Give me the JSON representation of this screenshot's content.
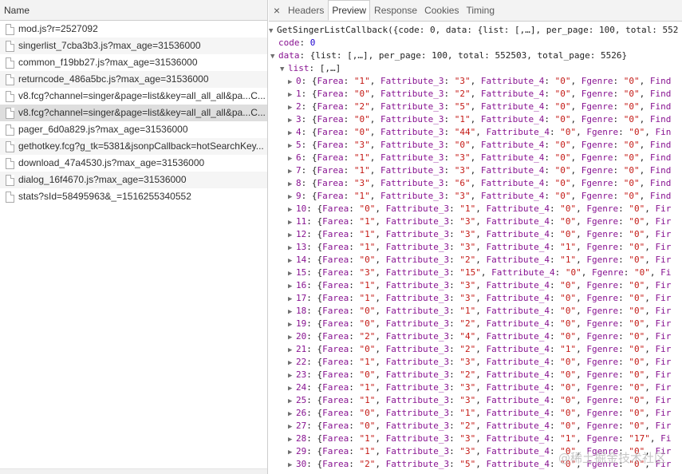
{
  "network": {
    "header": "Name",
    "requests": [
      "mod.js?r=2527092",
      "singerlist_7cba3b3.js?max_age=31536000",
      "common_f19bb27.js?max_age=31536000",
      "returncode_486a5bc.js?max_age=31536000",
      "v8.fcg?channel=singer&page=list&key=all_all_all&pa...C...",
      "v8.fcg?channel=singer&page=list&key=all_all_all&pa...C...",
      "pager_6d0a829.js?max_age=31536000",
      "gethotkey.fcg?g_tk=5381&jsonpCallback=hotSearchKey...",
      "download_47a4530.js?max_age=31536000",
      "dialog_16f4670.js?max_age=31536000",
      "stats?sId=58495963&_=1516255340552"
    ],
    "selected_index": 5
  },
  "detail": {
    "close_icon": "×",
    "tabs": [
      "Headers",
      "Preview",
      "Response",
      "Cookies",
      "Timing"
    ],
    "active_tab": 1
  },
  "preview": {
    "root": "GetSingerListCallback({code: 0, data: {list: [,…], per_page: 100, total: 552",
    "code_key": "code",
    "code_val": "0",
    "data_key": "data",
    "data_summary": "{list: [,…], per_page: 100, total: 552503, total_page: 5526}",
    "list_key": "list",
    "list_summary": "[,…]",
    "items": [
      {
        "i": "0",
        "farea": "1",
        "f3": "3",
        "f4": "0",
        "fgenre": "0",
        "tail": "Find"
      },
      {
        "i": "1",
        "farea": "0",
        "f3": "2",
        "f4": "0",
        "fgenre": "0",
        "tail": "Find"
      },
      {
        "i": "2",
        "farea": "2",
        "f3": "5",
        "f4": "0",
        "fgenre": "0",
        "tail": "Find"
      },
      {
        "i": "3",
        "farea": "0",
        "f3": "1",
        "f4": "0",
        "fgenre": "0",
        "tail": "Find"
      },
      {
        "i": "4",
        "farea": "0",
        "f3": "44",
        "f4": "0",
        "fgenre": "0",
        "tail": "Fin"
      },
      {
        "i": "5",
        "farea": "3",
        "f3": "0",
        "f4": "0",
        "fgenre": "0",
        "tail": "Find"
      },
      {
        "i": "6",
        "farea": "1",
        "f3": "3",
        "f4": "0",
        "fgenre": "0",
        "tail": "Find"
      },
      {
        "i": "7",
        "farea": "1",
        "f3": "3",
        "f4": "0",
        "fgenre": "0",
        "tail": "Find"
      },
      {
        "i": "8",
        "farea": "3",
        "f3": "6",
        "f4": "0",
        "fgenre": "0",
        "tail": "Find"
      },
      {
        "i": "9",
        "farea": "1",
        "f3": "3",
        "f4": "0",
        "fgenre": "0",
        "tail": "Find"
      },
      {
        "i": "10",
        "farea": "0",
        "f3": "1",
        "f4": "0",
        "fgenre": "0",
        "tail": "Fir"
      },
      {
        "i": "11",
        "farea": "1",
        "f3": "3",
        "f4": "0",
        "fgenre": "0",
        "tail": "Fir"
      },
      {
        "i": "12",
        "farea": "1",
        "f3": "3",
        "f4": "0",
        "fgenre": "0",
        "tail": "Fir"
      },
      {
        "i": "13",
        "farea": "1",
        "f3": "3",
        "f4": "1",
        "fgenre": "0",
        "tail": "Fir"
      },
      {
        "i": "14",
        "farea": "0",
        "f3": "2",
        "f4": "1",
        "fgenre": "0",
        "tail": "Fir"
      },
      {
        "i": "15",
        "farea": "3",
        "f3": "15",
        "f4": "0",
        "fgenre": "0",
        "tail": "Fi"
      },
      {
        "i": "16",
        "farea": "1",
        "f3": "3",
        "f4": "0",
        "fgenre": "0",
        "tail": "Fir"
      },
      {
        "i": "17",
        "farea": "1",
        "f3": "3",
        "f4": "0",
        "fgenre": "0",
        "tail": "Fir"
      },
      {
        "i": "18",
        "farea": "0",
        "f3": "1",
        "f4": "0",
        "fgenre": "0",
        "tail": "Fir"
      },
      {
        "i": "19",
        "farea": "0",
        "f3": "2",
        "f4": "0",
        "fgenre": "0",
        "tail": "Fir"
      },
      {
        "i": "20",
        "farea": "2",
        "f3": "4",
        "f4": "0",
        "fgenre": "0",
        "tail": "Fir"
      },
      {
        "i": "21",
        "farea": "0",
        "f3": "2",
        "f4": "1",
        "fgenre": "0",
        "tail": "Fir"
      },
      {
        "i": "22",
        "farea": "1",
        "f3": "3",
        "f4": "0",
        "fgenre": "0",
        "tail": "Fir"
      },
      {
        "i": "23",
        "farea": "0",
        "f3": "2",
        "f4": "0",
        "fgenre": "0",
        "tail": "Fir"
      },
      {
        "i": "24",
        "farea": "1",
        "f3": "3",
        "f4": "0",
        "fgenre": "0",
        "tail": "Fir"
      },
      {
        "i": "25",
        "farea": "1",
        "f3": "3",
        "f4": "0",
        "fgenre": "0",
        "tail": "Fir"
      },
      {
        "i": "26",
        "farea": "0",
        "f3": "1",
        "f4": "0",
        "fgenre": "0",
        "tail": "Fir"
      },
      {
        "i": "27",
        "farea": "0",
        "f3": "2",
        "f4": "0",
        "fgenre": "0",
        "tail": "Fir"
      },
      {
        "i": "28",
        "farea": "1",
        "f3": "3",
        "f4": "1",
        "fgenre": "17",
        "tail": "Fi"
      },
      {
        "i": "29",
        "farea": "1",
        "f3": "3",
        "f4": "0",
        "fgenre": "0",
        "tail": "Fir"
      },
      {
        "i": "30",
        "farea": "2",
        "f3": "5",
        "f4": "0",
        "fgenre": "0",
        "tail": "Fir"
      }
    ]
  },
  "watermark": "@稀土掘金技术社区"
}
